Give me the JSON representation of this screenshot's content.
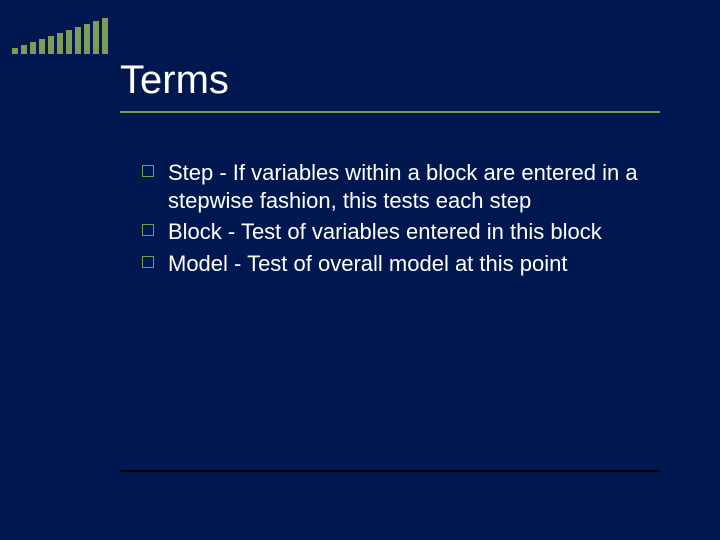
{
  "title": "Terms",
  "items": [
    "Step - If variables within a block are entered in a stepwise fashion, this tests each step",
    "Block - Test of variables entered in this block",
    "Model - Test of overall model at this point"
  ]
}
